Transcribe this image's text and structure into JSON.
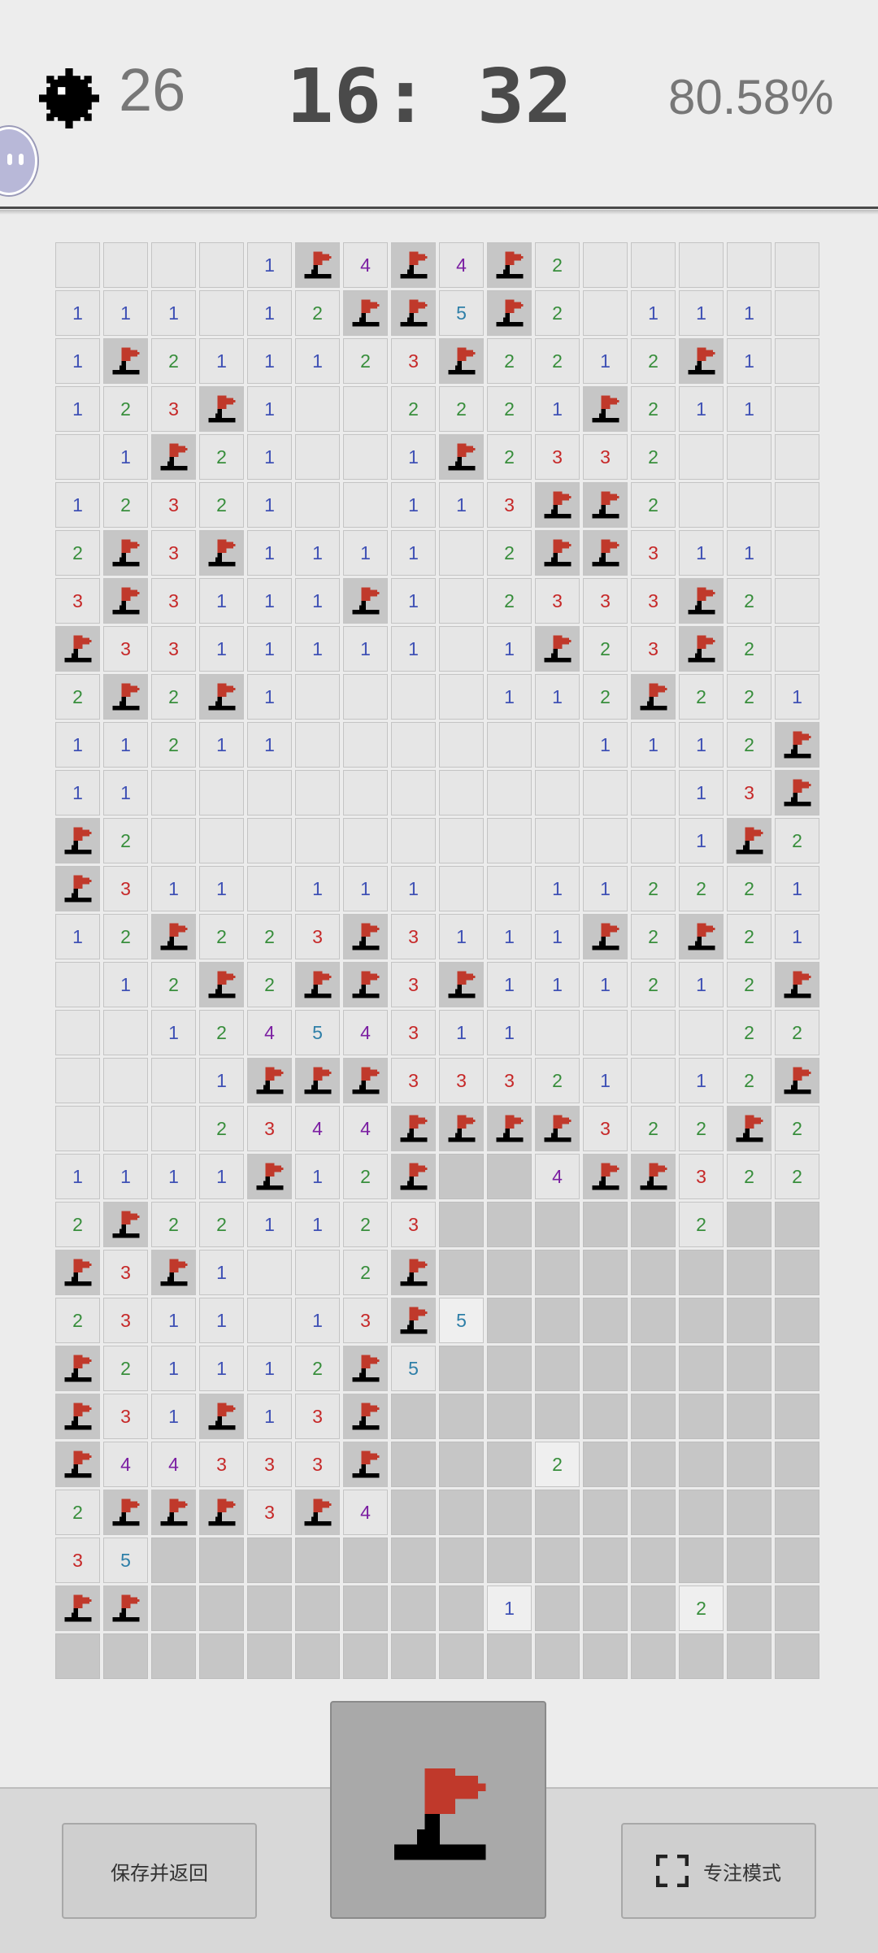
{
  "header": {
    "mine_icon": "mine-icon",
    "mines_remaining": "26",
    "timer": "16: 32",
    "progress": "80.58%"
  },
  "colors": {
    "n1": "#3f51b5",
    "n2": "#388e3c",
    "n3": "#c62828",
    "n4": "#7b1fa2",
    "n5": "#2e7fa8",
    "flag_red": "#c0392b",
    "flag_base": "#000000",
    "closed_cell": "#c6c6c6",
    "open_cell": "#e6e6e6"
  },
  "board": {
    "cols": 16,
    "rows": 30,
    "legend": "0=empty open, 1-8=number, F=flag, X=unopened, H=highlighted empty",
    "grid": [
      "0000.1F4F4F20000",
      "111.12FF5F2.111.",
      "1F2111123F22121F1.",
      "123F1..2221F211.",
      ".1F21..1F2332...",
      "12321..113FF2...",
      "2F3F1111.2FF311.",
      "3F31111F1.2333F2.",
      "F331111.1F23F2.",
      "2F2F1....112F221",
      "11211......1112F",
      "11.........13F",
      "F2.........1F2",
      "F311.111..1122221",
      "12F223F3111F2F21",
      ".12F2FF3F111212F",
      "..12454311....22",
      "...1FFF33321.12F",
      "...234FFFFF322F2",
      "11111F12FXX4FF322",
      "2F22112FXXXXXX2XX",
      "F3F1..2FXXXXXXXX",
      "2311.13F5XXXXXXX",
      "F21112F5XXXXXXXX",
      "F31F13FXXXXXXXXX",
      "F44333FXXX2XXXXX",
      "2FFF3F4XXXXXXXXX",
      "35XXXXXXXXXXXXXX",
      "FFXXXXXXX1XXX2XX",
      "XXXXXXXXXXXXXXXX"
    ],
    "rows_data": [
      [
        "0",
        "0",
        "0",
        "0",
        "1",
        "F",
        "4",
        "F",
        "4",
        "F",
        "2",
        "0",
        "0",
        "0",
        "0",
        "0"
      ],
      [
        "1",
        "1",
        "1",
        "0",
        "1",
        "2",
        "F",
        "F",
        "5",
        "F",
        "2",
        "0",
        "1",
        "1",
        "1",
        "0"
      ],
      [
        "1",
        "F",
        "2",
        "1",
        "1",
        "1",
        "2",
        "3",
        "F",
        "2",
        "2",
        "1",
        "2",
        "F",
        "1",
        "0"
      ],
      [
        "1",
        "2",
        "3",
        "F",
        "1",
        "0",
        "0",
        "2",
        "2",
        "2",
        "1",
        "F",
        "2",
        "1",
        "1",
        "0"
      ],
      [
        "0",
        "1",
        "F",
        "2",
        "1",
        "0",
        "0",
        "1",
        "F",
        "2",
        "3",
        "3",
        "2",
        "0",
        "0",
        "0"
      ],
      [
        "1",
        "2",
        "3",
        "2",
        "1",
        "0",
        "0",
        "1",
        "1",
        "3",
        "F",
        "F",
        "2",
        "0",
        "0",
        "0"
      ],
      [
        "2",
        "F",
        "3",
        "F",
        "1",
        "1",
        "1",
        "1",
        "0",
        "2",
        "F",
        "F",
        "3",
        "1",
        "1",
        "0"
      ],
      [
        "3",
        "F",
        "3",
        "1",
        "1",
        "1",
        "F",
        "1",
        "0",
        "2",
        "3",
        "3",
        "3",
        "F",
        "2",
        "0"
      ],
      [
        "F",
        "3",
        "3",
        "1",
        "1",
        "1",
        "1",
        "1",
        "0",
        "1",
        "F",
        "2",
        "3",
        "F",
        "2",
        "0"
      ],
      [
        "2",
        "F",
        "2",
        "F",
        "1",
        "0",
        "0",
        "0",
        "0",
        "1",
        "1",
        "2",
        "F",
        "2",
        "2",
        "1"
      ],
      [
        "1",
        "1",
        "2",
        "1",
        "1",
        "0",
        "0",
        "0",
        "0",
        "0",
        "0",
        "1",
        "1",
        "1",
        "2",
        "F"
      ],
      [
        "1",
        "1",
        "0",
        "0",
        "0",
        "0",
        "0",
        "0",
        "0",
        "0",
        "0",
        "0",
        "0",
        "1",
        "3",
        "F"
      ],
      [
        "F",
        "2",
        "0",
        "0",
        "0",
        "0",
        "0",
        "0",
        "0",
        "0",
        "0",
        "0",
        "0",
        "1",
        "F",
        "2"
      ],
      [
        "F",
        "3",
        "1",
        "1",
        "0",
        "1",
        "1",
        "1",
        "0",
        "0",
        "1",
        "1",
        "2",
        "2",
        "2",
        "1"
      ],
      [
        "1",
        "2",
        "F",
        "2",
        "2",
        "3",
        "F",
        "3",
        "1",
        "1",
        "1",
        "F",
        "2",
        "F",
        "2",
        "1"
      ],
      [
        "0",
        "1",
        "2",
        "F",
        "2",
        "F",
        "F",
        "3",
        "F",
        "1",
        "1",
        "1",
        "2",
        "1",
        "2",
        "F"
      ],
      [
        "0",
        "0",
        "1",
        "2",
        "4",
        "5",
        "4",
        "3",
        "1",
        "1",
        "0",
        "0",
        "0",
        "0",
        "2",
        "2"
      ],
      [
        "0",
        "0",
        "0",
        "1",
        "F",
        "F",
        "F",
        "3",
        "3",
        "3",
        "2",
        "1",
        "0",
        "1",
        "2",
        "F"
      ],
      [
        "0",
        "0",
        "0",
        "2",
        "3",
        "4",
        "4",
        "F",
        "F",
        "F",
        "F",
        "3",
        "2",
        "2",
        "F",
        "2"
      ],
      [
        "1",
        "1",
        "1",
        "1",
        "F",
        "1",
        "2",
        "F",
        "X",
        "X",
        "4",
        "F",
        "F",
        "3",
        "2",
        "2"
      ],
      [
        "2",
        "F",
        "2",
        "2",
        "1",
        "1",
        "2",
        "3",
        "X",
        "X",
        "X",
        "X",
        "X",
        "2",
        "X",
        "X"
      ],
      [
        "F",
        "3",
        "F",
        "1",
        "0",
        "0",
        "2",
        "F",
        "X",
        "X",
        "X",
        "X",
        "X",
        "X",
        "X",
        "X"
      ],
      [
        "2",
        "3",
        "1",
        "1",
        "0",
        "1",
        "3",
        "F",
        "H5",
        "X",
        "X",
        "X",
        "X",
        "X",
        "X",
        "X"
      ],
      [
        "F",
        "2",
        "1",
        "1",
        "1",
        "2",
        "F",
        "5",
        "X",
        "X",
        "X",
        "X",
        "X",
        "X",
        "X",
        "X"
      ],
      [
        "F",
        "3",
        "1",
        "F",
        "1",
        "3",
        "F",
        "X",
        "X",
        "X",
        "X",
        "X",
        "X",
        "X",
        "X",
        "X"
      ],
      [
        "F",
        "4",
        "4",
        "3",
        "3",
        "3",
        "F",
        "X",
        "X",
        "X",
        "H2",
        "X",
        "X",
        "X",
        "X",
        "X"
      ],
      [
        "2",
        "F",
        "F",
        "F",
        "3",
        "F",
        "4",
        "X",
        "X",
        "X",
        "X",
        "X",
        "X",
        "X",
        "X",
        "X"
      ],
      [
        "3",
        "5",
        "X",
        "X",
        "X",
        "X",
        "X",
        "X",
        "X",
        "X",
        "X",
        "X",
        "X",
        "X",
        "X",
        "X"
      ],
      [
        "F",
        "F",
        "X",
        "X",
        "X",
        "X",
        "X",
        "X",
        "X",
        "H1",
        "X",
        "X",
        "X",
        "H2",
        "X",
        "X"
      ],
      [
        "X",
        "X",
        "X",
        "X",
        "X",
        "X",
        "X",
        "X",
        "X",
        "X",
        "X",
        "X",
        "X",
        "X",
        "X",
        "X"
      ]
    ]
  },
  "controls": {
    "save_label": "保存并返回",
    "mode_icon": "flag-icon",
    "focus_label": "专注模式",
    "focus_icon": "fullscreen-icon"
  }
}
